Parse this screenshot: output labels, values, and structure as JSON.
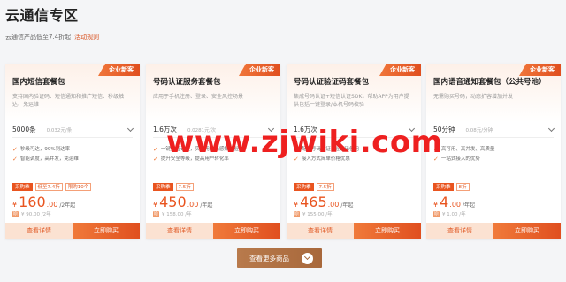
{
  "header": {
    "title": "云通信专区",
    "subtitle": "云通信产品低至7.4折起",
    "rule_link": "活动规则"
  },
  "more_button": {
    "label": "查看更多商品"
  },
  "watermark": "www.zjwiki.com",
  "colors": {
    "accent": "#e9541f",
    "accent_light": "#fbe2d2",
    "more_button": "#b07246",
    "watermark": "#ee2020"
  },
  "cards": [
    {
      "badge": "企业新客",
      "name": "国内短信套餐包",
      "desc": "支持国内验证码、短信通知和推广短信、秒级触达、免运维",
      "selector": {
        "value": "5000条",
        "unit_price": "0.032元/条"
      },
      "features": [
        "秒级可达，99%到达率",
        "智能调度，高并发，免运维"
      ],
      "tags": [
        {
          "text": "采购季",
          "solid": true
        },
        {
          "text": "低至7.4折",
          "solid": false
        },
        {
          "text": "限购10个",
          "solid": false
        }
      ],
      "price": {
        "currency": "¥",
        "amount": "160",
        "decimal": ".00",
        "per": "/2年起"
      },
      "original": "¥ 90.00 /2年",
      "btn_detail": "查看详情",
      "btn_buy": "立即购买"
    },
    {
      "badge": "企业新客",
      "name": "号码认证服务套餐包",
      "desc": "应用于手机注册、登录、安全风控场景",
      "selector": {
        "value": "1.6万次",
        "unit_price": "0.0281元/次"
      },
      "features": [
        "一键免密认证，实现用户无感知校验",
        "提升安全等级，提高用户转化率"
      ],
      "tags": [
        {
          "text": "采购季",
          "solid": true
        },
        {
          "text": "7.5折",
          "solid": false
        }
      ],
      "price": {
        "currency": "¥",
        "amount": "450",
        "decimal": ".00",
        "per": "/年起"
      },
      "original": "¥ 158.00 /年",
      "btn_detail": "查看详情",
      "btn_buy": "立即购买"
    },
    {
      "badge": "企业新客",
      "name": "号码认证验证码套餐包",
      "desc": "集成号码认证+短信认证SDK，帮助APP为用户提供包括一键登录/本机号码校验",
      "selector": {
        "value": "1.6万次",
        "unit_price": ""
      },
      "features": [
        "配套号码认证+验证码使用",
        "接入方式简单价格优惠"
      ],
      "tags": [
        {
          "text": "采购季",
          "solid": true
        },
        {
          "text": "7.5折",
          "solid": false
        }
      ],
      "price": {
        "currency": "¥",
        "amount": "465",
        "decimal": ".00",
        "per": "/年起"
      },
      "original": "¥ 155.00 /年",
      "btn_detail": "查看详情",
      "btn_buy": "立即购买"
    },
    {
      "badge": "企业新客",
      "name": "国内语音通知套餐包（公共号池）",
      "desc": "无需购买号码，动态扩容增加并发",
      "selector": {
        "value": "50分钟",
        "unit_price": "0.08元/分钟"
      },
      "features": [
        "高可用、高并发、高质量",
        "一站式接入的优势"
      ],
      "tags": [
        {
          "text": "采购季",
          "solid": true
        },
        {
          "text": "8折",
          "solid": false
        }
      ],
      "price": {
        "currency": "¥",
        "amount": "4",
        "decimal": ".00",
        "per": "/年起"
      },
      "original": "¥ 1.00 /年",
      "btn_detail": "查看详情",
      "btn_buy": "立即购买"
    }
  ]
}
